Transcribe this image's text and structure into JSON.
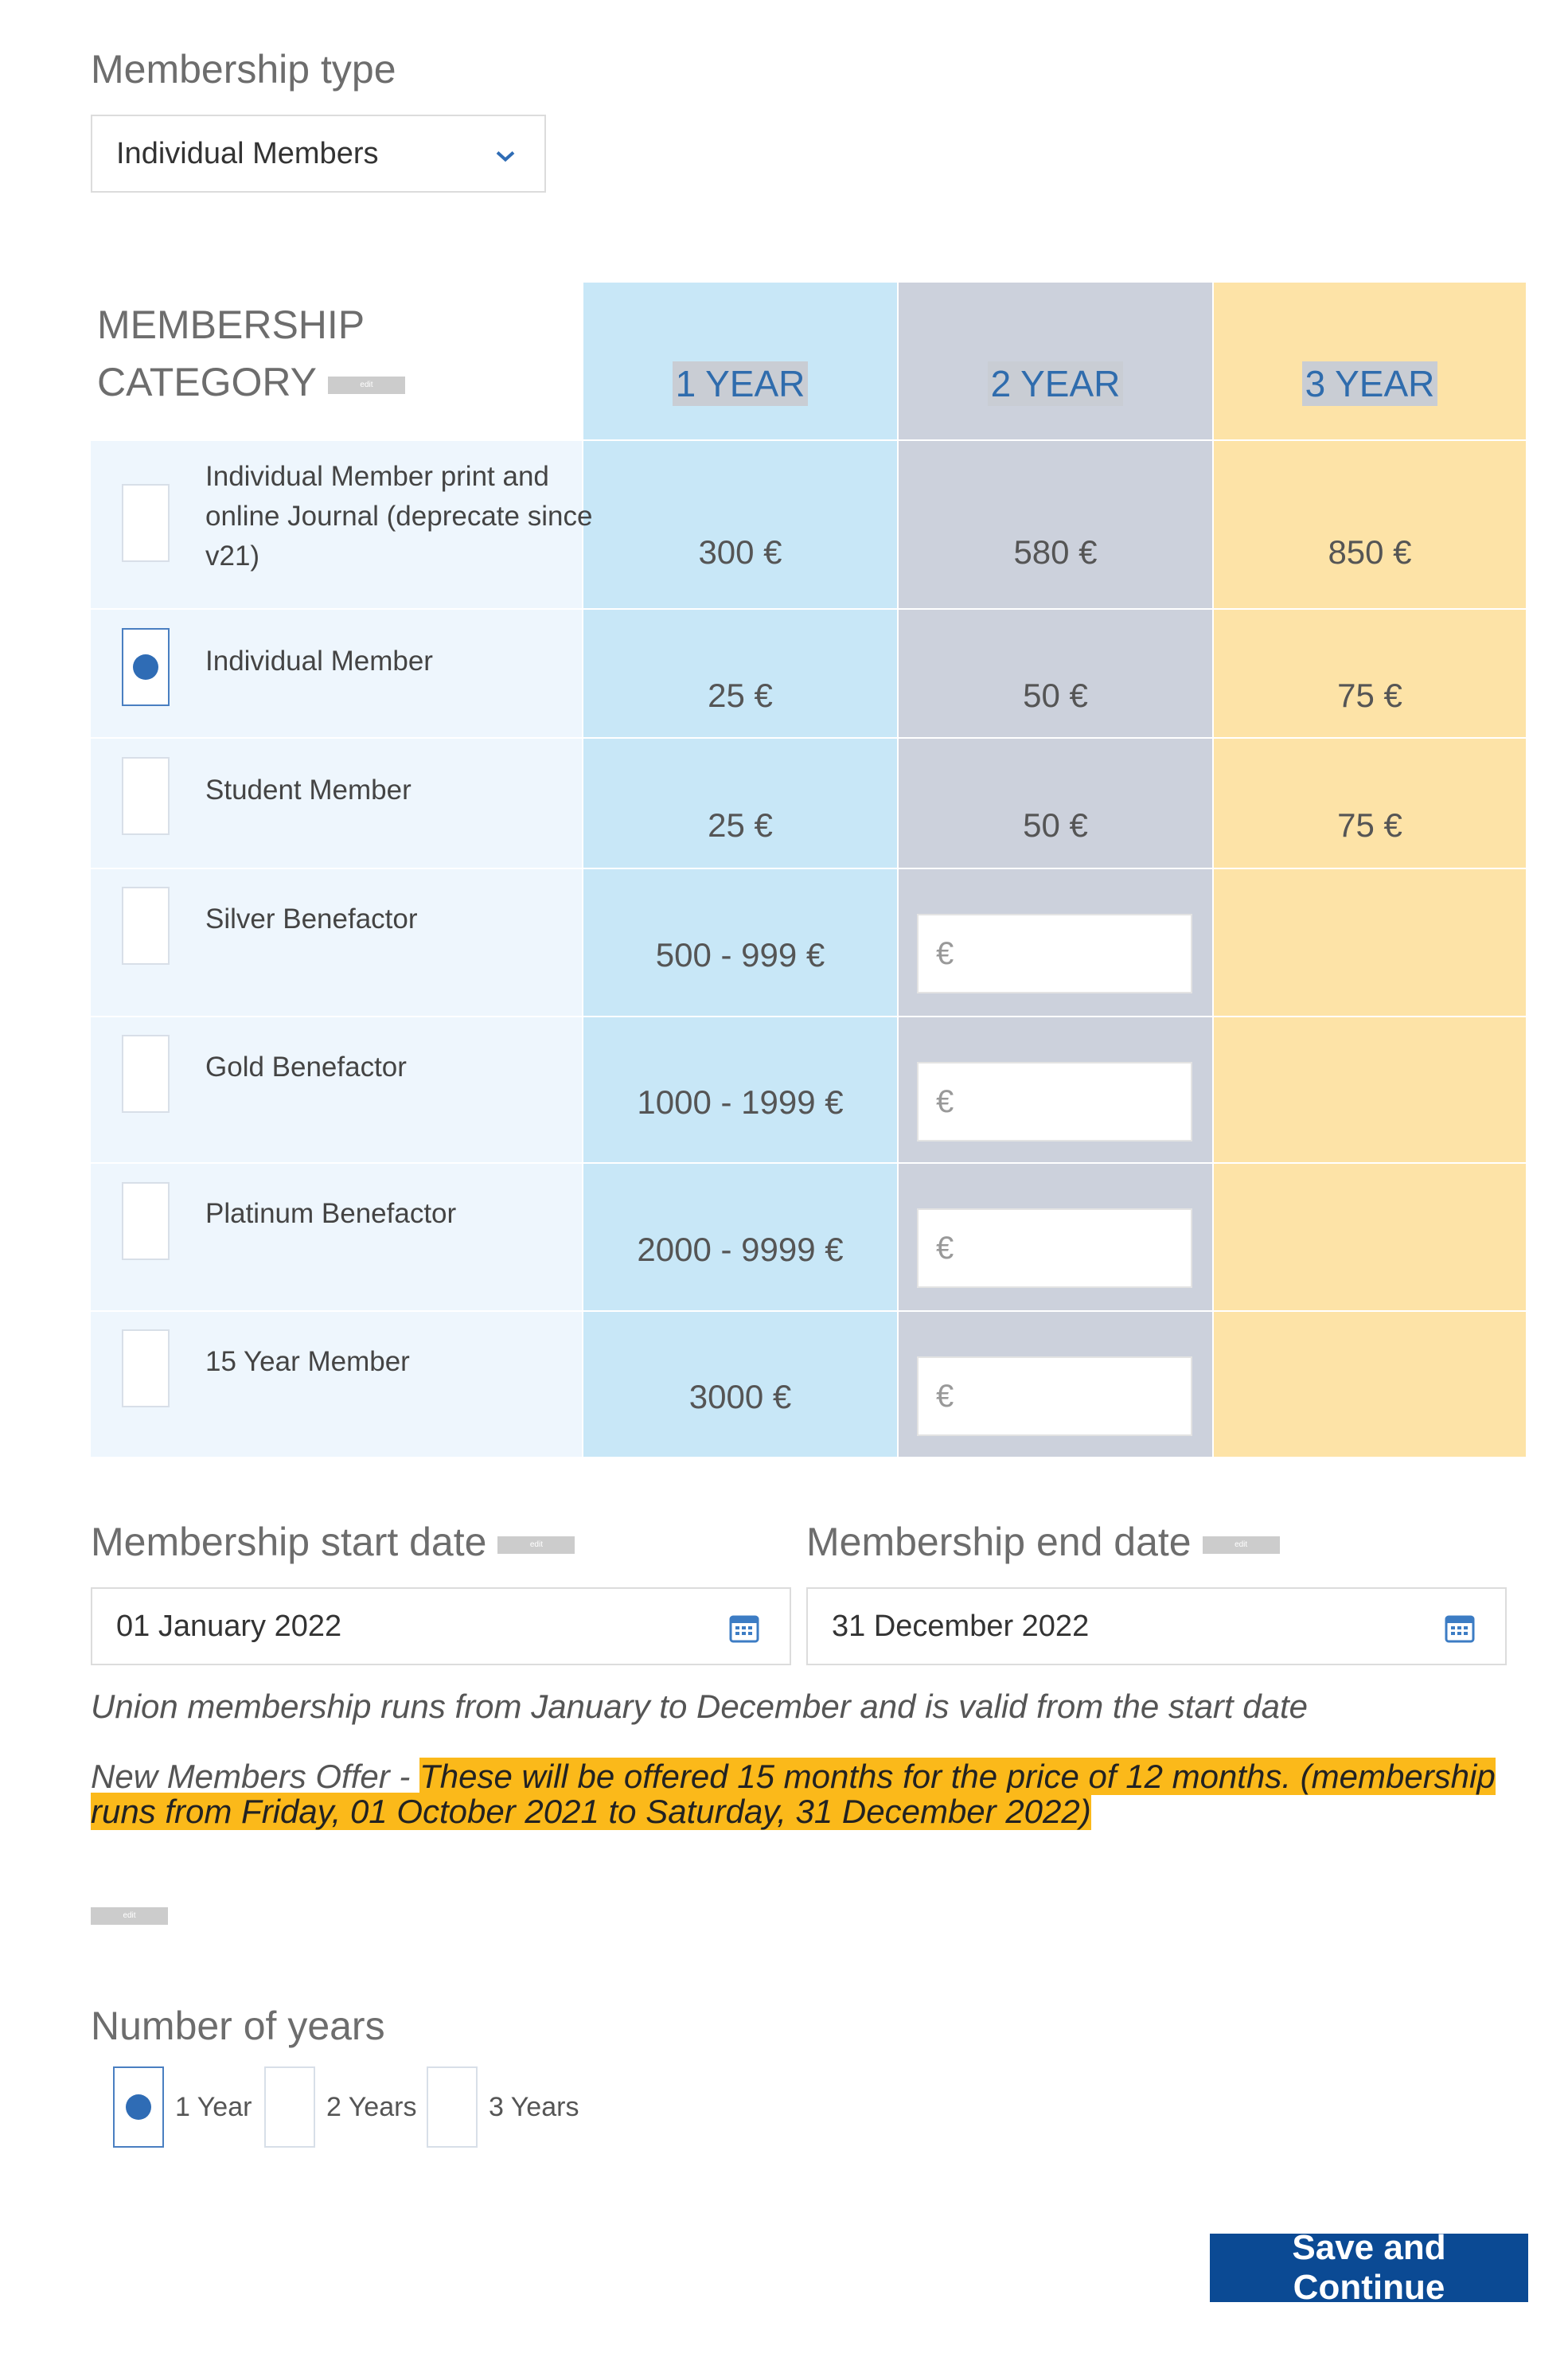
{
  "membership_type": {
    "label": "Membership type",
    "selected": "Individual Members"
  },
  "edit_tag": "edit",
  "table": {
    "category_header_line1": "MEMBERSHIP",
    "category_header_line2": "CATEGORY",
    "columns": [
      "1 YEAR",
      "2 YEAR",
      "3 YEAR"
    ],
    "euro_placeholder": "€",
    "rows": [
      {
        "name_line1": "Individual Member print and",
        "name_line2": "online Journal (deprecate since",
        "name_line3": "v21)",
        "y1": "300 €",
        "y2": "580 €",
        "y3": "850 €",
        "selected": false
      },
      {
        "name_line1": "Individual Member",
        "y1": "25 €",
        "y2": "50 €",
        "y3": "75 €",
        "selected": true
      },
      {
        "name_line1": "Student Member",
        "y1": "25 €",
        "y2": "50 €",
        "y3": "75 €",
        "selected": false
      },
      {
        "name_line1": "Silver Benefactor",
        "y1": "500 - 999 €",
        "selected": false
      },
      {
        "name_line1": "Gold Benefactor",
        "y1": "1000 - 1999 €",
        "selected": false
      },
      {
        "name_line1": "Platinum Benefactor",
        "y1": "2000 - 9999 €",
        "selected": false
      },
      {
        "name_line1": "15 Year Member",
        "y1": "3000 €",
        "selected": false
      }
    ]
  },
  "start_date": {
    "label": "Membership start date",
    "value": "01 January 2022"
  },
  "end_date": {
    "label": "Membership end date",
    "value": "31 December 2022"
  },
  "notes": {
    "union": "Union membership runs from January to December and is valid from the start date",
    "offer_prefix": "New Members Offer - ",
    "offer_line1": "These will be offered 15 months for the price of 12 months. (membership",
    "offer_line2": "runs from Friday, 01 October 2021 to Saturday, 31 December 2022)"
  },
  "years": {
    "label": "Number of years",
    "options": [
      "1 Year",
      "2 Years",
      "3 Years"
    ],
    "selected": "1 Year"
  },
  "save_label": "Save and Continue",
  "colors": {
    "accent": "#0b4a94",
    "highlight": "#fbb91a",
    "col1": "#c8e7f7",
    "col2": "#ccd1dc",
    "col3": "#fde3a7"
  }
}
